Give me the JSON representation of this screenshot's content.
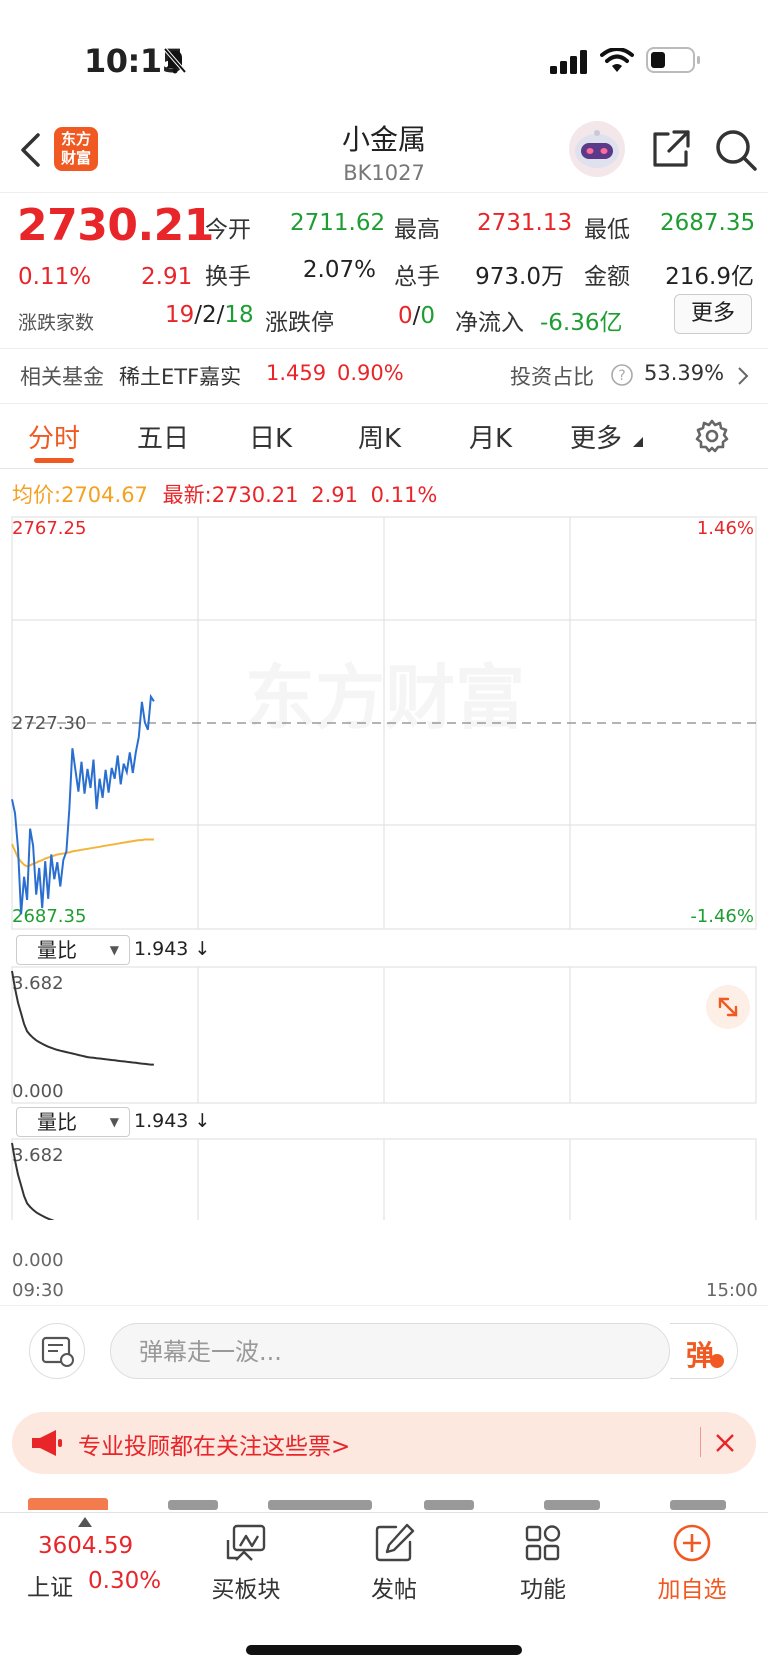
{
  "status": {
    "time": "10:15"
  },
  "header": {
    "logo_text": "东方财富",
    "title": "小金属",
    "code": "BK1027"
  },
  "quote": {
    "price": "2730.21",
    "pct": "0.11%",
    "change": "2.91",
    "open_label": "今开",
    "open": "2711.62",
    "high_label": "最高",
    "high": "2731.13",
    "low_label": "最低",
    "low": "2687.35",
    "turnover_label": "换手",
    "turnover": "2.07%",
    "volume_label": "总手",
    "volume": "973.0万",
    "amount_label": "金额",
    "amount": "216.9亿",
    "breadth_label": "涨跌家数",
    "breadth_up": "19",
    "breadth_flat": "2",
    "breadth_down": "18",
    "limit_label": "涨跌停",
    "limit_up": "0",
    "limit_down": "0",
    "netflow_label": "净流入",
    "netflow": "-6.36亿",
    "more_label": "更多"
  },
  "fund": {
    "label": "相关基金",
    "name": "稀土ETF嘉实",
    "price": "1.459",
    "pct": "0.90%",
    "ratio_label": "投资占比",
    "ratio": "53.39%"
  },
  "tabs": [
    {
      "label": "分时",
      "active": true
    },
    {
      "label": "五日"
    },
    {
      "label": "日K"
    },
    {
      "label": "周K"
    },
    {
      "label": "月K"
    },
    {
      "label": "更多"
    }
  ],
  "info_line": {
    "avg_label": "均价:",
    "avg": "2704.67",
    "latest_label": "最新:",
    "latest": "2730.21",
    "change": "2.91",
    "pct": "0.11%"
  },
  "chart_data": {
    "type": "line",
    "title": "",
    "y_max_label": "2767.25",
    "y_mid_label": "2727.30",
    "y_min_label": "2687.35",
    "pct_max_label": "1.46%",
    "pct_min_label": "-1.46%",
    "ylim": [
      2687.35,
      2767.25
    ],
    "x_start_label": "09:30",
    "x_end_label": "15:00",
    "watermark": "东方财富",
    "series": [
      {
        "name": "最新",
        "color": "#2a6fd0",
        "values": [
          2712.5,
          2709.8,
          2703.0,
          2690.2,
          2697.5,
          2693.0,
          2706.8,
          2703.5,
          2694.0,
          2699.2,
          2691.4,
          2700.5,
          2693.2,
          2701.8,
          2697.0,
          2700.3,
          2695.6,
          2700.7,
          2702.4,
          2710.8,
          2722.4,
          2718.2,
          2714.0,
          2719.8,
          2713.6,
          2718.4,
          2714.7,
          2720.2,
          2710.6,
          2716.5,
          2712.8,
          2718.2,
          2713.8,
          2718.6,
          2716.5,
          2721.0,
          2715.4,
          2719.4,
          2717.8,
          2721.6,
          2717.6,
          2721.6,
          2724.6,
          2731.4,
          2727.4,
          2726.0,
          2732.4,
          2731.5
        ]
      },
      {
        "name": "均价",
        "color": "#f4b43a",
        "values": [
          2703.8,
          2702.5,
          2701.2,
          2700.4,
          2699.8,
          2699.5,
          2699.7,
          2700.0,
          2700.2,
          2700.5,
          2700.7,
          2701.0,
          2701.2,
          2701.4,
          2701.6,
          2701.8,
          2701.9,
          2702.0,
          2702.1,
          2702.2,
          2702.4,
          2702.5,
          2702.6,
          2702.7,
          2702.8,
          2702.9,
          2703.0,
          2703.1,
          2703.2,
          2703.3,
          2703.4,
          2703.5,
          2703.6,
          2703.7,
          2703.8,
          2703.9,
          2704.0,
          2704.1,
          2704.2,
          2704.3,
          2704.4,
          2704.5,
          2704.6,
          2704.6,
          2704.7,
          2704.7,
          2704.7,
          2704.7
        ]
      }
    ],
    "sub_charts": [
      {
        "indicator": "量比",
        "value": "1.943",
        "max_label": "3.682",
        "min_label": "0.000",
        "ylim": [
          0,
          3.682
        ],
        "values": [
          3.682,
          3.2,
          2.8,
          2.5,
          2.2,
          2.0,
          1.9,
          1.82,
          1.75,
          1.7,
          1.65,
          1.61,
          1.57,
          1.54,
          1.51,
          1.48,
          1.46,
          1.44,
          1.42,
          1.4,
          1.38,
          1.36,
          1.34,
          1.32,
          1.3,
          1.28,
          1.27,
          1.26,
          1.25,
          1.24,
          1.23,
          1.22,
          1.21,
          1.2,
          1.19,
          1.18,
          1.17,
          1.16,
          1.15,
          1.14,
          1.13,
          1.12,
          1.11,
          1.1,
          1.09,
          1.08,
          1.07,
          1.07
        ]
      },
      {
        "indicator": "量比",
        "value": "1.943",
        "max_label": "3.682",
        "min_label": "0.000",
        "ylim": [
          0,
          3.682
        ],
        "values": [
          3.682,
          3.2,
          2.8,
          2.5,
          2.2,
          2.0,
          1.9,
          1.82,
          1.75,
          1.7,
          1.65,
          1.61,
          1.57,
          1.54,
          1.51,
          1.48,
          1.46,
          1.44,
          1.42,
          1.4,
          1.38,
          1.36,
          1.34,
          1.32,
          1.3,
          1.28,
          1.27,
          1.26,
          1.25,
          1.24,
          1.23,
          1.22,
          1.21,
          1.2,
          1.19,
          1.18,
          1.17,
          1.16,
          1.15,
          1.14,
          1.13,
          1.12,
          1.11,
          1.1,
          1.09,
          1.08,
          1.07,
          1.07
        ]
      }
    ]
  },
  "comment": {
    "placeholder": "弹幕走一波...",
    "danmu_btn": "弹"
  },
  "banner": {
    "text": "专业投顾都在关注这些票>"
  },
  "bottom": {
    "index_value": "3604.59",
    "index_name": "上证",
    "index_pct": "0.30%",
    "nav": [
      {
        "label": "买板块"
      },
      {
        "label": "发帖"
      },
      {
        "label": "功能"
      },
      {
        "label": "加自选"
      }
    ]
  },
  "colors": {
    "up": "#e8262a",
    "down": "#1e9e32",
    "accent": "#f05a22",
    "avg_line": "#f4b43a",
    "price_line": "#2a6fd0"
  }
}
